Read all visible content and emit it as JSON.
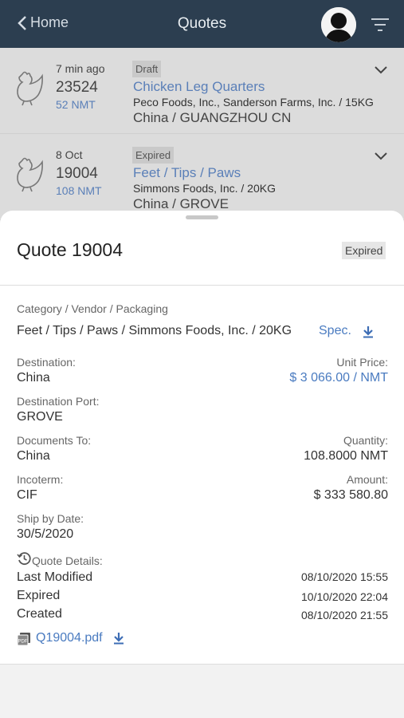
{
  "header": {
    "back_label": "Home",
    "title": "Quotes"
  },
  "quotes": [
    {
      "time": "7 min ago",
      "number": "23524",
      "nmt": "52 NMT",
      "status": "Draft",
      "category": "Chicken Leg Quarters",
      "vendors": "Peco Foods, Inc., Sanderson Farms, Inc. / 15KG",
      "destination": "China / GUANGZHOU CN"
    },
    {
      "time": "8 Oct",
      "number": "19004",
      "nmt": "108 NMT",
      "status": "Expired",
      "category": "Feet / Tips / Paws",
      "vendors": "Simmons Foods, Inc. / 20KG",
      "destination": "China / GROVE"
    }
  ],
  "detail": {
    "title": "Quote 19004",
    "status": "Expired",
    "cvp_label": "Category / Vendor / Packaging",
    "cvp_value": "Feet / Tips / Paws / Simmons Foods, Inc. / 20KG",
    "spec_label": "Spec.",
    "destination_label": "Destination:",
    "destination_value": "China",
    "unit_price_label": "Unit Price:",
    "unit_price_value": "$ 3 066.00 / NMT",
    "port_label": "Destination Port:",
    "port_value": "GROVE",
    "docs_label": "Documents To:",
    "docs_value": "China",
    "quantity_label": "Quantity:",
    "quantity_value": "108.8000 NMT",
    "incoterm_label": "Incoterm:",
    "incoterm_value": "CIF",
    "amount_label": "Amount:",
    "amount_value": "$ 333 580.80",
    "ship_label": "Ship by Date:",
    "ship_value": "30/5/2020",
    "details_label": "Quote Details:",
    "last_modified_label": "Last Modified",
    "last_modified_value": "08/10/2020 15:55",
    "expired_label": "Expired",
    "expired_value": "10/10/2020 22:04",
    "created_label": "Created",
    "created_value": "08/10/2020 21:55",
    "pdf_label": "Q19004.pdf"
  },
  "colors": {
    "header_bg": "#2c3e50",
    "link": "#4a7bc0"
  }
}
